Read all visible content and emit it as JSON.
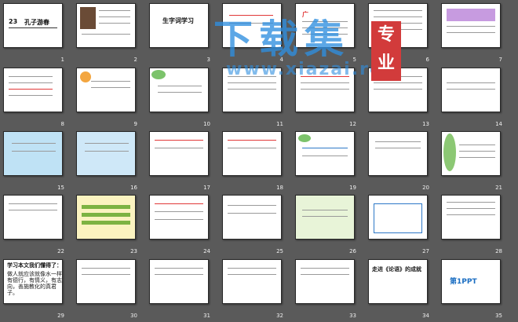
{
  "slide_numbers": [
    "1",
    "2",
    "3",
    "4",
    "5",
    "6",
    "7",
    "8",
    "9",
    "10",
    "11",
    "12",
    "13",
    "14",
    "15",
    "16",
    "17",
    "18",
    "19",
    "20",
    "21",
    "22",
    "23",
    "24",
    "25",
    "26",
    "27",
    "28",
    "29",
    "30",
    "31",
    "32",
    "33",
    "34",
    "35"
  ],
  "slide1": {
    "number": "23",
    "title": "孔子游春"
  },
  "slide3": {
    "title": "生字词学习"
  },
  "slide5": {
    "label": "广"
  },
  "slide29": {
    "title": "学习本文我们懂得了：",
    "body": "做人就应该就像水一样有德行，有情义，有志向，善施教化的真君子。"
  },
  "slide34": {
    "title": "走进《论语》的成就"
  },
  "slide35": {
    "brand": "第1PPT"
  },
  "watermark": {
    "main": "下载集",
    "site": "www.xiazai.red",
    "stamp": "专业"
  }
}
